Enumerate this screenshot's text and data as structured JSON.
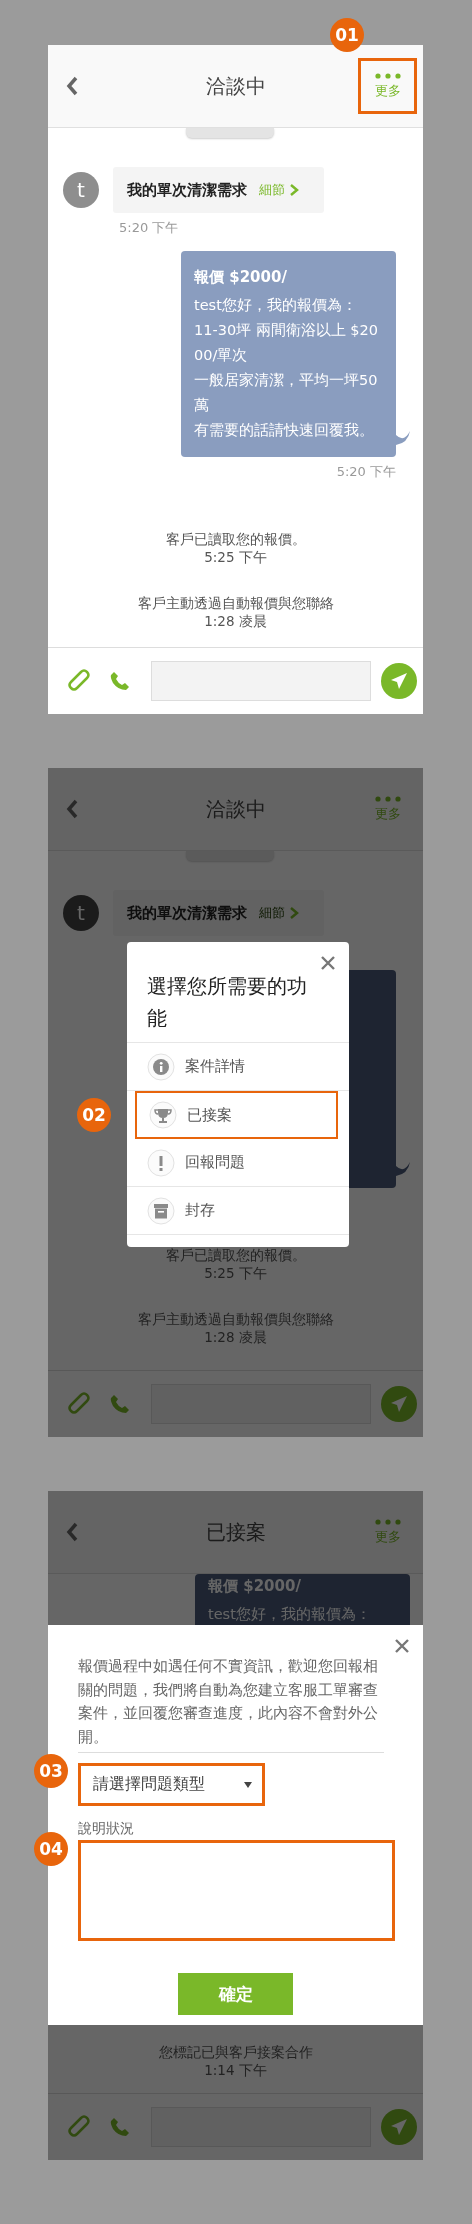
{
  "screens": [
    {
      "kind": "chat",
      "header": {
        "title": "洽談中",
        "more": {
          "label": "更多",
          "highlighted": true,
          "callout": "01"
        }
      },
      "messages": [
        {
          "kind": "request",
          "avatar": "t",
          "text": "我的單次清潔需求",
          "link": "細節",
          "time": "5:20 下午"
        },
        {
          "kind": "quote",
          "title": "報價 $2000/",
          "lines": [
            "test您好，我的報價為：",
            "11-30坪 兩間衛浴以上 $2000/單次",
            "一般居家清潔，平均一坪50萬",
            "有需要的話請快速回覆我。"
          ],
          "time": "5:20 下午"
        },
        {
          "kind": "system",
          "text": "客戶已讀取您的報價。",
          "time": "5:25 下午"
        },
        {
          "kind": "system",
          "text": "客戶主動透過自動報價與您聯絡",
          "time": "1:28 凌晨"
        }
      ]
    },
    {
      "kind": "menu",
      "header": {
        "title": "洽談中",
        "more": {
          "label": "更多",
          "highlighted": false
        }
      },
      "messages": [
        {
          "kind": "request",
          "avatar": "t",
          "text": "我的單次清潔需求",
          "link": "細節"
        },
        {
          "kind": "quote"
        },
        {
          "kind": "system",
          "text": "客戶已讀取您的報價。",
          "time": "5:25 下午"
        },
        {
          "kind": "system",
          "text": "客戶主動透過自動報價與您聯絡",
          "time": "1:28 凌晨"
        }
      ],
      "dialog": {
        "title": "選擇您所需要的功能",
        "items": [
          {
            "kind": "info",
            "label": "案件詳情",
            "highlighted": false
          },
          {
            "kind": "trophy",
            "label": "已接案",
            "highlighted": true,
            "callout": "02"
          },
          {
            "kind": "alert",
            "label": "回報問題",
            "highlighted": false
          },
          {
            "kind": "archive",
            "label": "封存",
            "highlighted": false
          }
        ]
      }
    },
    {
      "kind": "report",
      "header": {
        "title": "已接案",
        "more": {
          "label": "更多",
          "highlighted": false
        }
      },
      "messages": [
        {
          "kind": "quote",
          "title": "報價 $2000/",
          "lines": [
            "test您好，我的報價為："
          ]
        }
      ],
      "dialog": {
        "intro": "報價過程中如遇任何不實資訊，歡迎您回報相關的問題，我們將自動為您建立客服工單審查案件，並回覆您審查進度，此內容不會對外公開。",
        "select": {
          "placeholder": "請選擇問題類型",
          "highlighted": true,
          "callout": "03"
        },
        "label": "說明狀況",
        "textarea": {
          "highlighted": true,
          "callout": "04"
        },
        "confirm": "確定"
      },
      "footer_messages": [
        {
          "kind": "system",
          "text": "您標記已與客戶接案合作",
          "time": "1:14 下午"
        }
      ]
    }
  ]
}
